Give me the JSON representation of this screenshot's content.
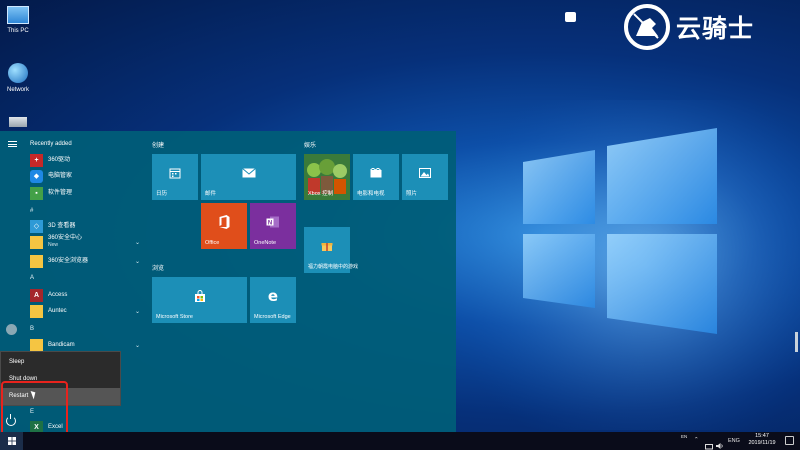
{
  "desktop": {
    "icons": [
      {
        "label": "This PC",
        "icon": "computer-icon"
      },
      {
        "label": "Network",
        "icon": "network-globe-icon"
      },
      {
        "label": "",
        "icon": "recycle-bin-icon"
      }
    ],
    "watermark_text": "云骑士",
    "watermark_logo": "knight-horse-logo"
  },
  "start_menu": {
    "list_title": "Recently added",
    "sections": [
      {
        "letter": "",
        "apps": [
          {
            "name": "360驱动",
            "icon": "360-driver-icon",
            "color": "#c62828",
            "chevron": false
          },
          {
            "name": "电脑管家",
            "icon": "pc-manager-icon",
            "color": "#1e88e5",
            "chevron": false
          },
          {
            "name": "软件管理",
            "icon": "software-manager-icon",
            "color": "#43a047",
            "chevron": false
          }
        ]
      },
      {
        "letter": "#",
        "apps": [
          {
            "name": "3D 查看器",
            "icon": "3d-viewer-icon",
            "color": "#2e9ad6",
            "chevron": false
          },
          {
            "name": "360安全中心",
            "sub": "New",
            "icon": "folder-icon",
            "color": "#f5c542",
            "chevron": true
          },
          {
            "name": "360安全浏览器",
            "icon": "folder-icon",
            "color": "#f5c542",
            "chevron": true
          }
        ]
      },
      {
        "letter": "A",
        "apps": [
          {
            "name": "Access",
            "icon": "access-icon",
            "color": "#a4262c",
            "chevron": false
          },
          {
            "name": "Auntec",
            "icon": "folder-icon",
            "color": "#f5c542",
            "chevron": true
          }
        ]
      },
      {
        "letter": "B",
        "apps": [
          {
            "name": "Bandicam",
            "icon": "folder-icon",
            "color": "#f5c542",
            "chevron": true
          }
        ]
      },
      {
        "letter": "E",
        "apps": [
          {
            "name": "Excel",
            "icon": "excel-icon",
            "color": "#1e7145",
            "chevron": false
          }
        ]
      }
    ],
    "groups": [
      {
        "title": "创建",
        "tiles": [
          {
            "label": "日历",
            "icon": "calendar-icon",
            "color": "#1c8fb7"
          },
          {
            "label": "邮件",
            "icon": "mail-icon",
            "color": "#1c8fb7"
          },
          {
            "label": "Office",
            "icon": "office-icon",
            "color": "#e04e1b"
          },
          {
            "label": "OneNote",
            "icon": "onenote-icon",
            "color": "#7b2f9e"
          }
        ]
      },
      {
        "title": "浏览",
        "tiles": [
          {
            "label": "Microsoft Store",
            "icon": "store-bag-icon",
            "color": "#1c8fb7"
          },
          {
            "label": "Microsoft Edge",
            "icon": "edge-icon",
            "color": "#1c8fb7"
          }
        ]
      },
      {
        "title": "娱乐",
        "tiles": [
          {
            "label": "Xbox 控制",
            "icon": "xbox-game-art",
            "color": "#2d6b2d"
          },
          {
            "label": "电影和电视",
            "icon": "film-icon",
            "color": "#1c8fb7"
          },
          {
            "label": "照片",
            "icon": "photo-icon",
            "color": "#1c8fb7"
          },
          {
            "label": "福力朝霞电脑中的游戏",
            "icon": "gift-box-icon",
            "color": "#1c8fb7"
          }
        ]
      }
    ]
  },
  "power_menu": {
    "items": [
      "Sleep",
      "Shut down",
      "Restart"
    ],
    "selected": "Restart"
  },
  "taskbar": {
    "tray_text_en": "EN",
    "language": "ENG",
    "time": "15:47",
    "date": "2019/11/19"
  },
  "colors": {
    "start_bg": "#005d78",
    "tile": "#1c8fb7",
    "office": "#e04e1b",
    "onenote": "#7b2f9e",
    "highlight": "#e8231d"
  }
}
